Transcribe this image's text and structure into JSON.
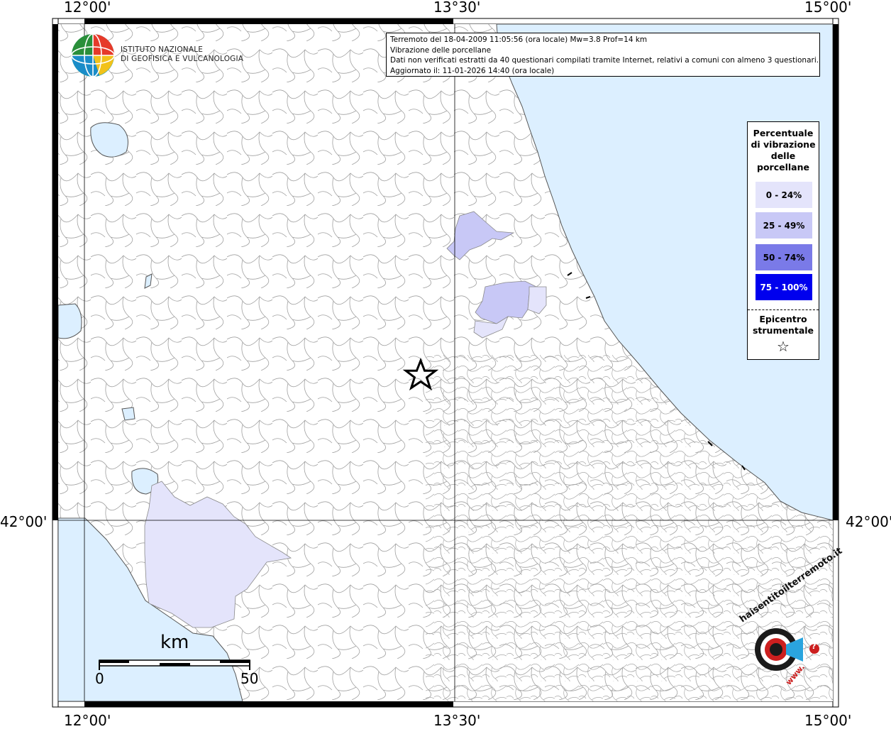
{
  "map": {
    "ticks": {
      "lon_left": "12°00'",
      "lon_mid": "13°30'",
      "lon_right": "15°00'",
      "lat": "42°00'"
    },
    "colors": {
      "sea": "#dcefff",
      "land": "#ffffff",
      "boundary": "#9a9a9a",
      "class_0_24": "#e4e4fb",
      "class_25_49": "#c8c8f6",
      "class_50_74": "#7a7ae8",
      "class_75_100": "#0000ee"
    },
    "epicenter_icon": "star-icon"
  },
  "logo": {
    "line1": "ISTITUTO NAZIONALE",
    "line2": "DI GEOFISICA E VULCANOLOGIA"
  },
  "info": {
    "line1": "Terremoto del 18-04-2009 11:05:56 (ora locale) Mw=3.8 Prof=14 km",
    "line2": "Vibrazione delle porcellane",
    "line3": "Dati non verificati estratti da 40 questionari compilati tramite Internet, relativi a comuni con almeno 3 questionari.",
    "line4": "Aggiornato il: 11-01-2026 14:40 (ora locale)"
  },
  "legend": {
    "title_line1": "Percentuale",
    "title_line2": "di vibrazione",
    "title_line3": "delle",
    "title_line4": "porcellane",
    "items": [
      {
        "label": "0 - 24%",
        "color": "#e4e4fb",
        "text_color": "#000000"
      },
      {
        "label": "25 - 49%",
        "color": "#c8c8f6",
        "text_color": "#000000"
      },
      {
        "label": "50 - 74%",
        "color": "#7a7ae8",
        "text_color": "#000000"
      },
      {
        "label": "75 - 100%",
        "color": "#0000ee",
        "text_color": "#ffffff"
      }
    ],
    "epicenter_line1": "Epicentro",
    "epicenter_line2": "strumentale"
  },
  "scale": {
    "unit": "km",
    "start": "0",
    "end": "50"
  },
  "watermark": {
    "text_arc": "haisentitoilterremoto.it",
    "www": "www.",
    "question": "?"
  }
}
